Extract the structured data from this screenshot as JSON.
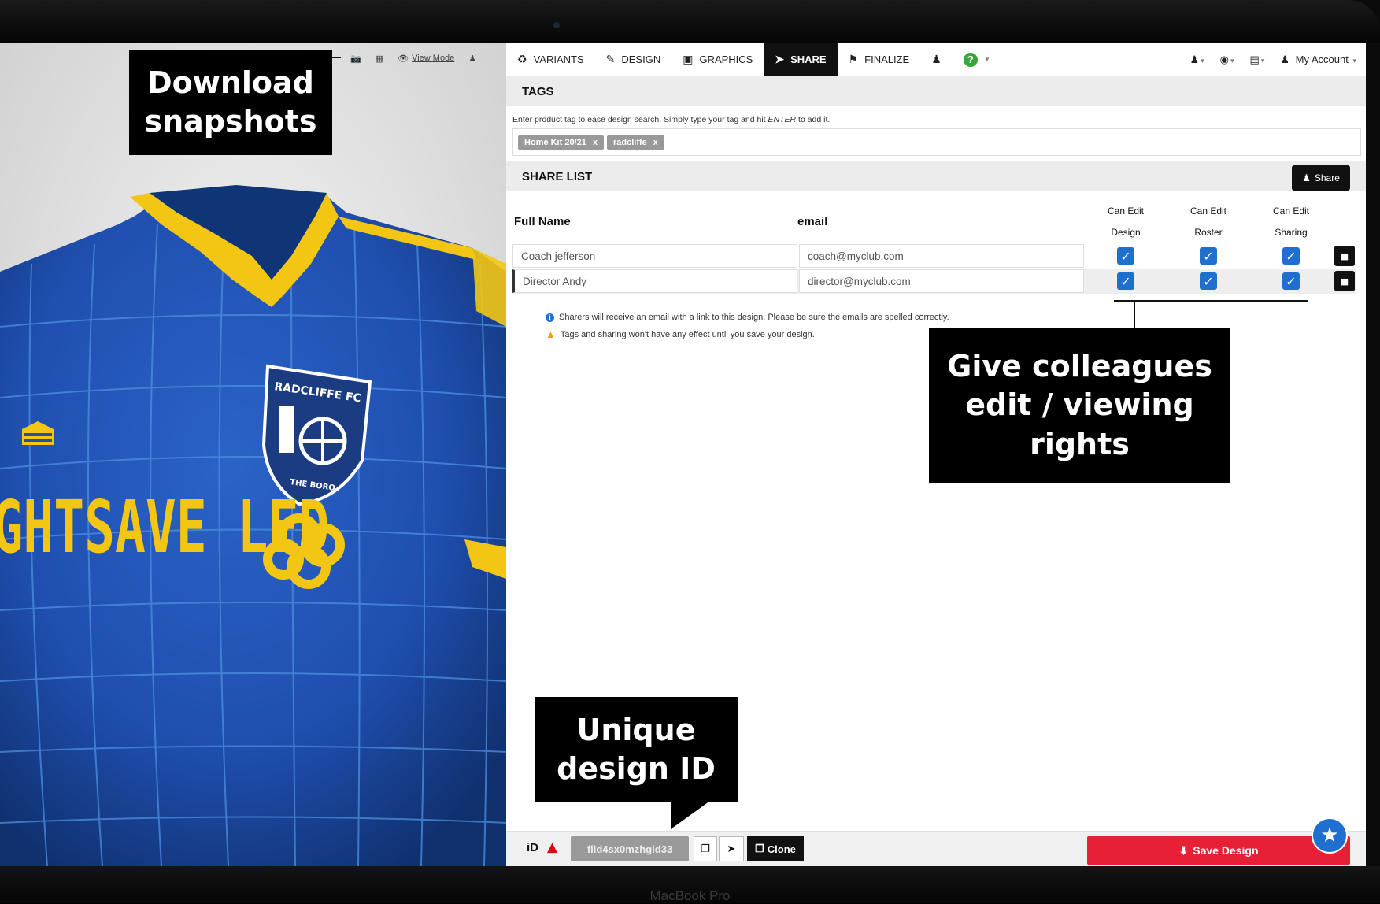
{
  "viewer": {
    "toolbar": {
      "view_mode_label": "View Mode"
    },
    "jersey": {
      "sponsor_text": "GHTSAVE LED",
      "crest_name": "RADCLIFFE FC",
      "crest_motto": "THE BORO"
    }
  },
  "nav": {
    "tabs": [
      {
        "label": "VARIANTS",
        "icon": "puzzle-icon",
        "active": false
      },
      {
        "label": "DESIGN",
        "icon": "pencil-icon",
        "active": false
      },
      {
        "label": "GRAPHICS",
        "icon": "image-icon",
        "active": false
      },
      {
        "label": "SHARE",
        "icon": "share-icon",
        "active": true
      },
      {
        "label": "FINALIZE",
        "icon": "flag-icon",
        "active": false
      }
    ],
    "account_label": "My Account"
  },
  "tags": {
    "heading": "TAGS",
    "help_text_pre": "Enter product tag to ease design search. Simply type your tag and hit ",
    "help_text_key": "ENTER",
    "help_text_post": " to add it.",
    "items": [
      "Home Kit 20/21",
      "radcliffe"
    ],
    "remove_glyph": "x"
  },
  "share_list": {
    "heading": "SHARE LIST",
    "share_button_label": "Share",
    "columns": {
      "full_name": "Full Name",
      "email": "email",
      "can_edit_design_1": "Can Edit",
      "can_edit_design_2": "Design",
      "can_edit_roster_1": "Can Edit",
      "can_edit_roster_2": "Roster",
      "can_edit_sharing_1": "Can Edit",
      "can_edit_sharing_2": "Sharing"
    },
    "rows": [
      {
        "name": "Coach jefferson",
        "email": "coach@myclub.com",
        "design": true,
        "roster": true,
        "sharing": true
      },
      {
        "name": "Director Andy",
        "email": "director@myclub.com",
        "design": true,
        "roster": true,
        "sharing": true
      }
    ],
    "notes": [
      "Sharers will receive an email with a link to this design. Please be sure the emails are spelled correctly.",
      "Tags and sharing won't have any effect until you save your design."
    ]
  },
  "footer": {
    "id_label": "iD",
    "design_id": "fild4sx0mzhgid33",
    "clone_label": "Clone",
    "save_label": "Save Design"
  },
  "callouts": {
    "download_1": "Download",
    "download_2": "snapshots",
    "give_1": "Give colleagues",
    "give_2": "edit / viewing",
    "give_3": "rights",
    "unique_1": "Unique",
    "unique_2": "design ID"
  },
  "device": {
    "brand": "MacBook Pro"
  },
  "colors": {
    "jersey_blue": "#1f4fb0",
    "jersey_yellow": "#f3c614",
    "save_red": "#e82036",
    "checkbox_blue": "#1f6fd1"
  }
}
